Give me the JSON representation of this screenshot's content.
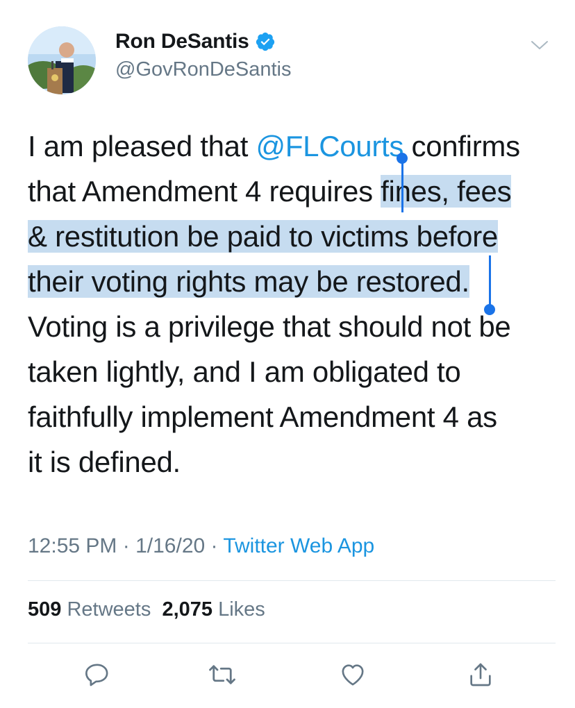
{
  "user": {
    "display_name": "Ron DeSantis",
    "handle": "@GovRonDeSantis",
    "verified_icon": "verified-badge-icon",
    "avatar": "profile-photo"
  },
  "tweet": {
    "line1_pre": "I am pleased that ",
    "line1_mention": "@FLCourts",
    "line1_post": " confirms",
    "line2_pre": "that Amendment 4 requires ",
    "line2_sel": "fines, fees",
    "line3_sel": "& restitution be paid to victims before",
    "line4_sel": "their voting rights may be restored.",
    "line5": "Voting is a privilege that should not be",
    "line6": "taken lightly, and I am obligated to",
    "line7": "faithfully implement Amendment 4 as",
    "line8": "it is defined."
  },
  "meta": {
    "time": "12:55 PM",
    "sep1": " · ",
    "date": "1/16/20",
    "sep2": " · ",
    "source": "Twitter Web App"
  },
  "stats": {
    "retweets_count": "509",
    "retweets_label": "Retweets",
    "likes_count": "2,075",
    "likes_label": "Likes"
  },
  "colors": {
    "accent": "#1b95e0",
    "selection": "#c6dcf0",
    "selection_handle": "#1a73e8",
    "secondary_text": "#657786"
  },
  "actions": [
    "reply-icon",
    "retweet-icon",
    "like-icon",
    "share-icon"
  ]
}
